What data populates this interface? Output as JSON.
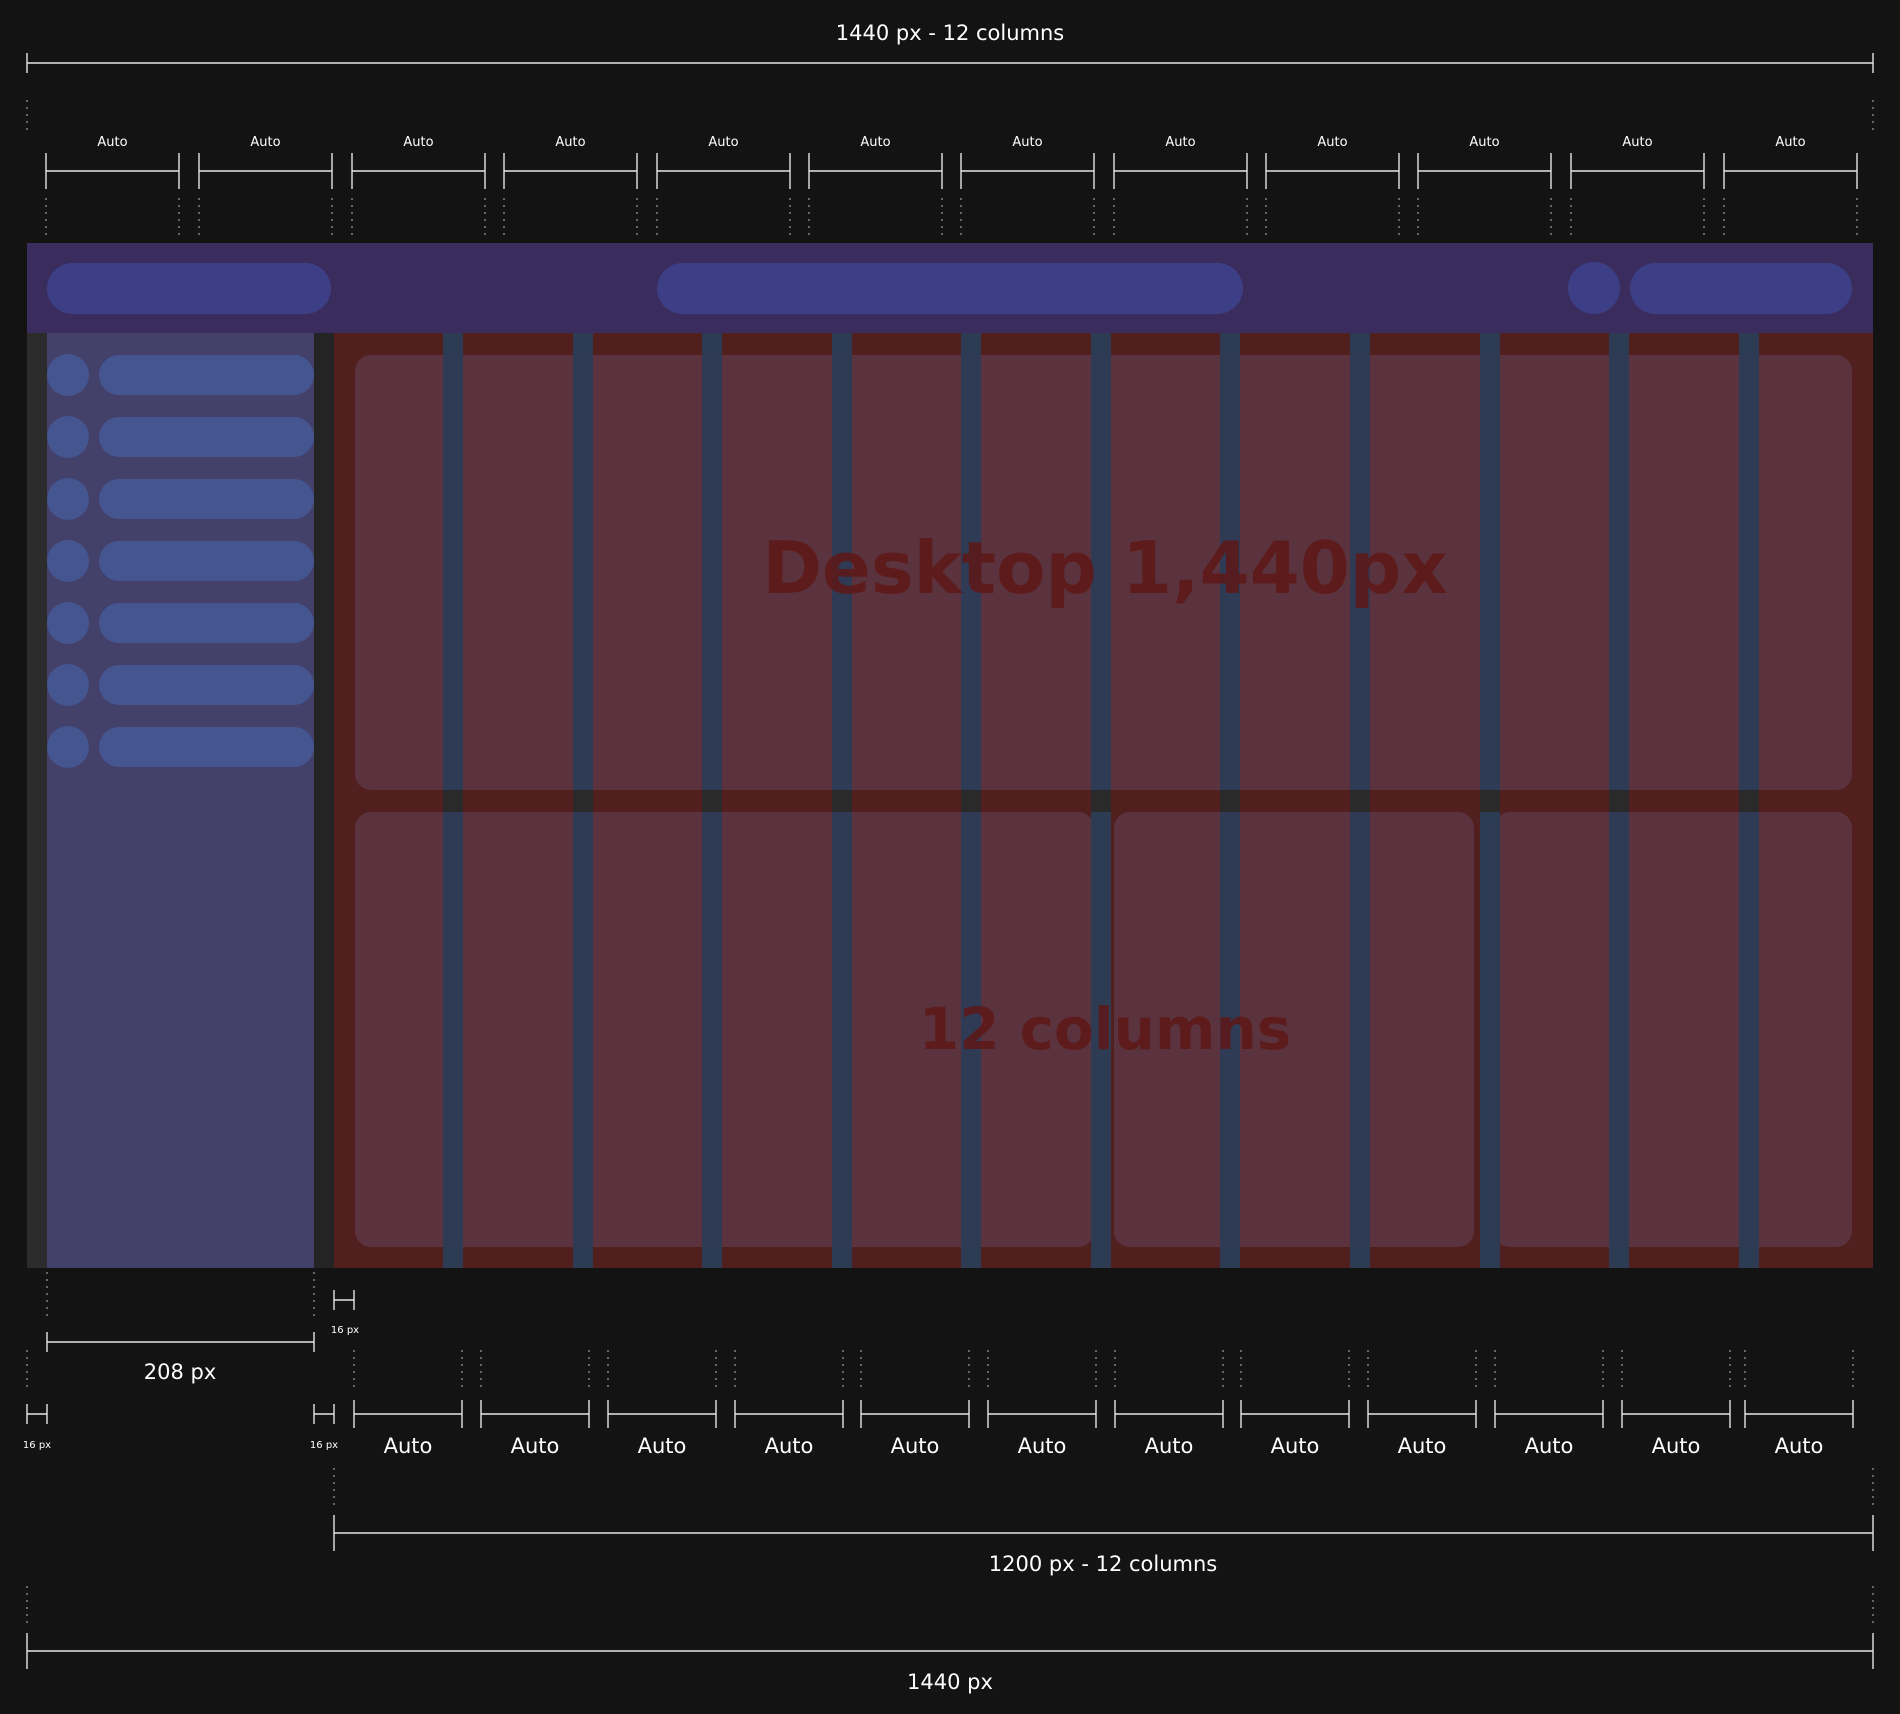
{
  "top": {
    "total_label": "1440 px - 12 columns",
    "column_label": "Auto"
  },
  "bottom": {
    "sidebar_width_label": "208 px",
    "gap_label": "16 px",
    "left_margin_label": "16 px",
    "sidebar_gap_label": "16 px",
    "column_label": "Auto",
    "content_label": "1200 px - 12 columns",
    "total_label": "1440 px"
  },
  "canvas": {
    "headline": "Desktop 1,440px",
    "subline": "12 columns"
  },
  "sidebar": {
    "item_count": 7
  },
  "colors": {
    "background": "#131313",
    "header": "#3a2c5c",
    "header_pill": "#3d3f86",
    "sidebar": "#43406a",
    "sidebar_pill": "#44558f",
    "content": "#521f1f",
    "card": "#5a333e",
    "gutter": "#2d3c55",
    "text_overlay": "#5f1717",
    "measure_line": "#e6e6e6"
  }
}
